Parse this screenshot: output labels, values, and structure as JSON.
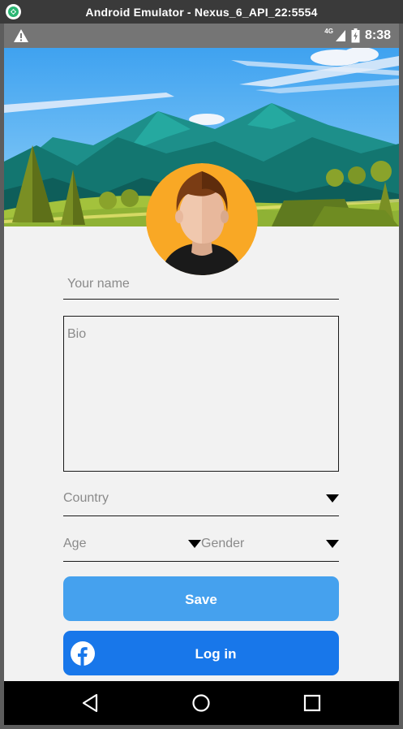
{
  "window": {
    "title": "Android Emulator - Nexus_6_API_22:5554"
  },
  "statusbar": {
    "network": "4G",
    "time": "8:38",
    "icons": [
      "warning-icon",
      "signal-icon",
      "battery-icon"
    ]
  },
  "form": {
    "name_placeholder": "Your name",
    "bio_placeholder": "Bio",
    "country_placeholder": "Country",
    "age_placeholder": "Age",
    "gender_placeholder": "Gender"
  },
  "buttons": {
    "save_label": "Save",
    "login_label": "Log in"
  },
  "navbar": {
    "icons": [
      "back-icon",
      "home-icon",
      "recents-icon"
    ]
  },
  "colors": {
    "save_button": "#45a1ee",
    "facebook_button": "#1877ea",
    "avatar_bg": "#f9a825",
    "statusbar": "#757575",
    "titlebar": "#3a3a3a"
  }
}
